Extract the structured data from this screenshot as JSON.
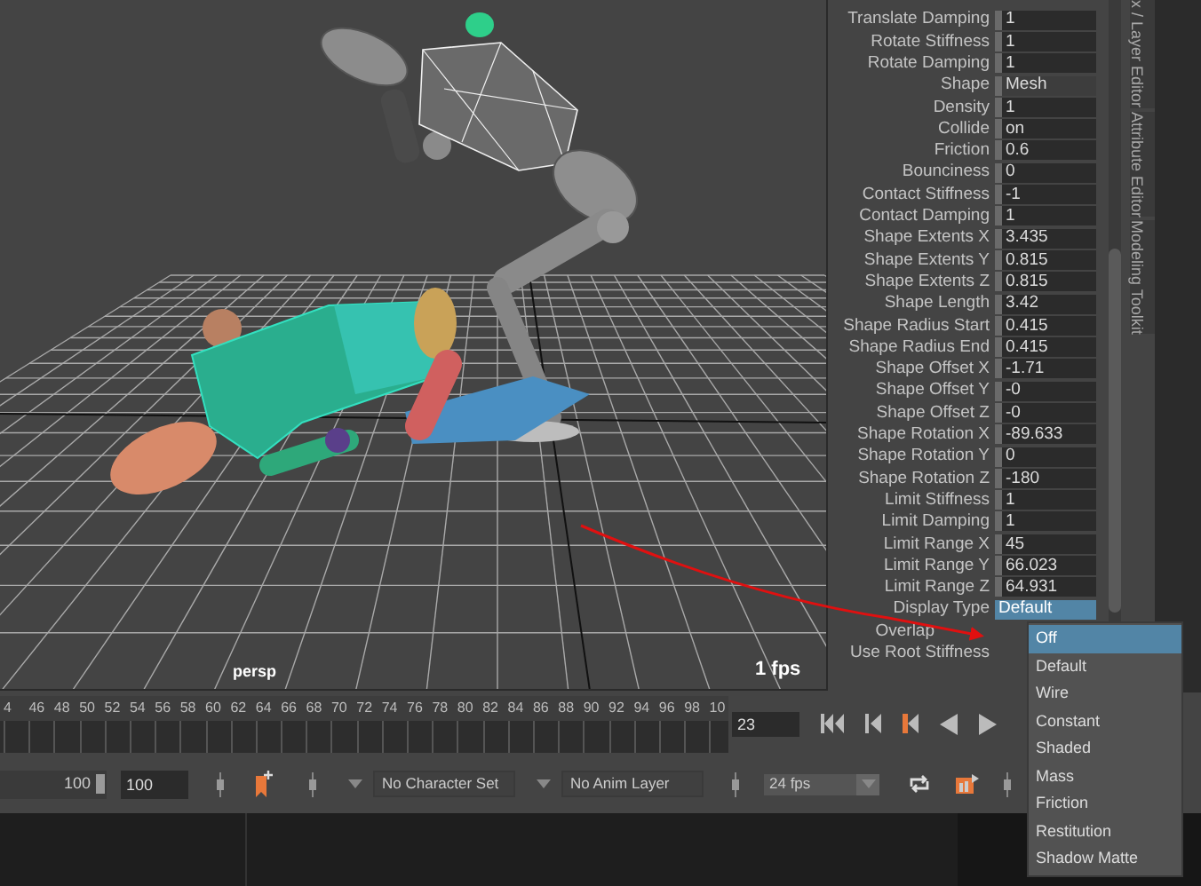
{
  "viewport": {
    "camera_label": "persp",
    "fps_label": "1 fps"
  },
  "attributes": [
    {
      "label": "Translate Damping",
      "value": "1",
      "kind": "number"
    },
    {
      "label": "Rotate Stiffness",
      "value": "1",
      "kind": "number"
    },
    {
      "label": "Rotate Damping",
      "value": "1",
      "kind": "number"
    },
    {
      "label": "Shape",
      "value": "Mesh",
      "kind": "enum"
    },
    {
      "label": "Density",
      "value": "1",
      "kind": "number"
    },
    {
      "label": "Collide",
      "value": "on",
      "kind": "number"
    },
    {
      "label": "Friction",
      "value": "0.6",
      "kind": "number"
    },
    {
      "label": "Bounciness",
      "value": "0",
      "kind": "number"
    },
    {
      "label": "Contact Stiffness",
      "value": "-1",
      "kind": "number"
    },
    {
      "label": "Contact Damping",
      "value": "1",
      "kind": "number"
    },
    {
      "label": "Shape Extents X",
      "value": "3.435",
      "kind": "number"
    },
    {
      "label": "Shape Extents Y",
      "value": "0.815",
      "kind": "number"
    },
    {
      "label": "Shape Extents Z",
      "value": "0.815",
      "kind": "number"
    },
    {
      "label": "Shape Length",
      "value": "3.42",
      "kind": "number"
    },
    {
      "label": "Shape Radius Start",
      "value": "0.415",
      "kind": "number"
    },
    {
      "label": "Shape Radius End",
      "value": "0.415",
      "kind": "number"
    },
    {
      "label": "Shape Offset X",
      "value": "-1.71",
      "kind": "number"
    },
    {
      "label": "Shape Offset Y",
      "value": "-0",
      "kind": "number"
    },
    {
      "label": "Shape Offset Z",
      "value": "-0",
      "kind": "number"
    },
    {
      "label": "Shape Rotation X",
      "value": "-89.633",
      "kind": "number"
    },
    {
      "label": "Shape Rotation Y",
      "value": "0",
      "kind": "number"
    },
    {
      "label": "Shape Rotation Z",
      "value": "-180",
      "kind": "number"
    },
    {
      "label": "Limit Stiffness",
      "value": "1",
      "kind": "number"
    },
    {
      "label": "Limit Damping",
      "value": "1",
      "kind": "number"
    },
    {
      "label": "Limit Range X",
      "value": "45",
      "kind": "number"
    },
    {
      "label": "Limit Range Y",
      "value": "66.023",
      "kind": "number"
    },
    {
      "label": "Limit Range Z",
      "value": "64.931",
      "kind": "number"
    },
    {
      "label": "Display Type",
      "value": "Default",
      "kind": "open-enum"
    },
    {
      "label": "Overlap",
      "kind": "covered"
    },
    {
      "label": "Use Root Stiffness",
      "kind": "blank"
    }
  ],
  "side_tabs": [
    "x / Layer Editor",
    "Attribute Editor",
    "Modeling Toolkit"
  ],
  "dropdown_menu": [
    {
      "label": "Off",
      "selected": true
    },
    {
      "label": "Default",
      "selected": false
    },
    {
      "label": "Wire",
      "selected": false
    },
    {
      "label": "Constant",
      "selected": false
    },
    {
      "label": "Shaded",
      "selected": false
    },
    {
      "label": "Mass",
      "selected": false
    },
    {
      "label": "Friction",
      "selected": false
    },
    {
      "label": "Restitution",
      "selected": false
    },
    {
      "label": "Shadow Matte",
      "selected": false
    }
  ],
  "timeline": {
    "ticks": [
      "4",
      "46",
      "48",
      "50",
      "52",
      "54",
      "56",
      "58",
      "60",
      "62",
      "64",
      "66",
      "68",
      "70",
      "72",
      "74",
      "76",
      "78",
      "80",
      "82",
      "84",
      "86",
      "88",
      "90",
      "92",
      "94",
      "96",
      "98",
      "10"
    ],
    "current_frame": "23"
  },
  "range_bar": {
    "range_end": "100",
    "level": 1,
    "end_field": "100",
    "character_set": "No Character Set",
    "anim_layer": "No Anim Layer",
    "fps": "24 fps"
  }
}
